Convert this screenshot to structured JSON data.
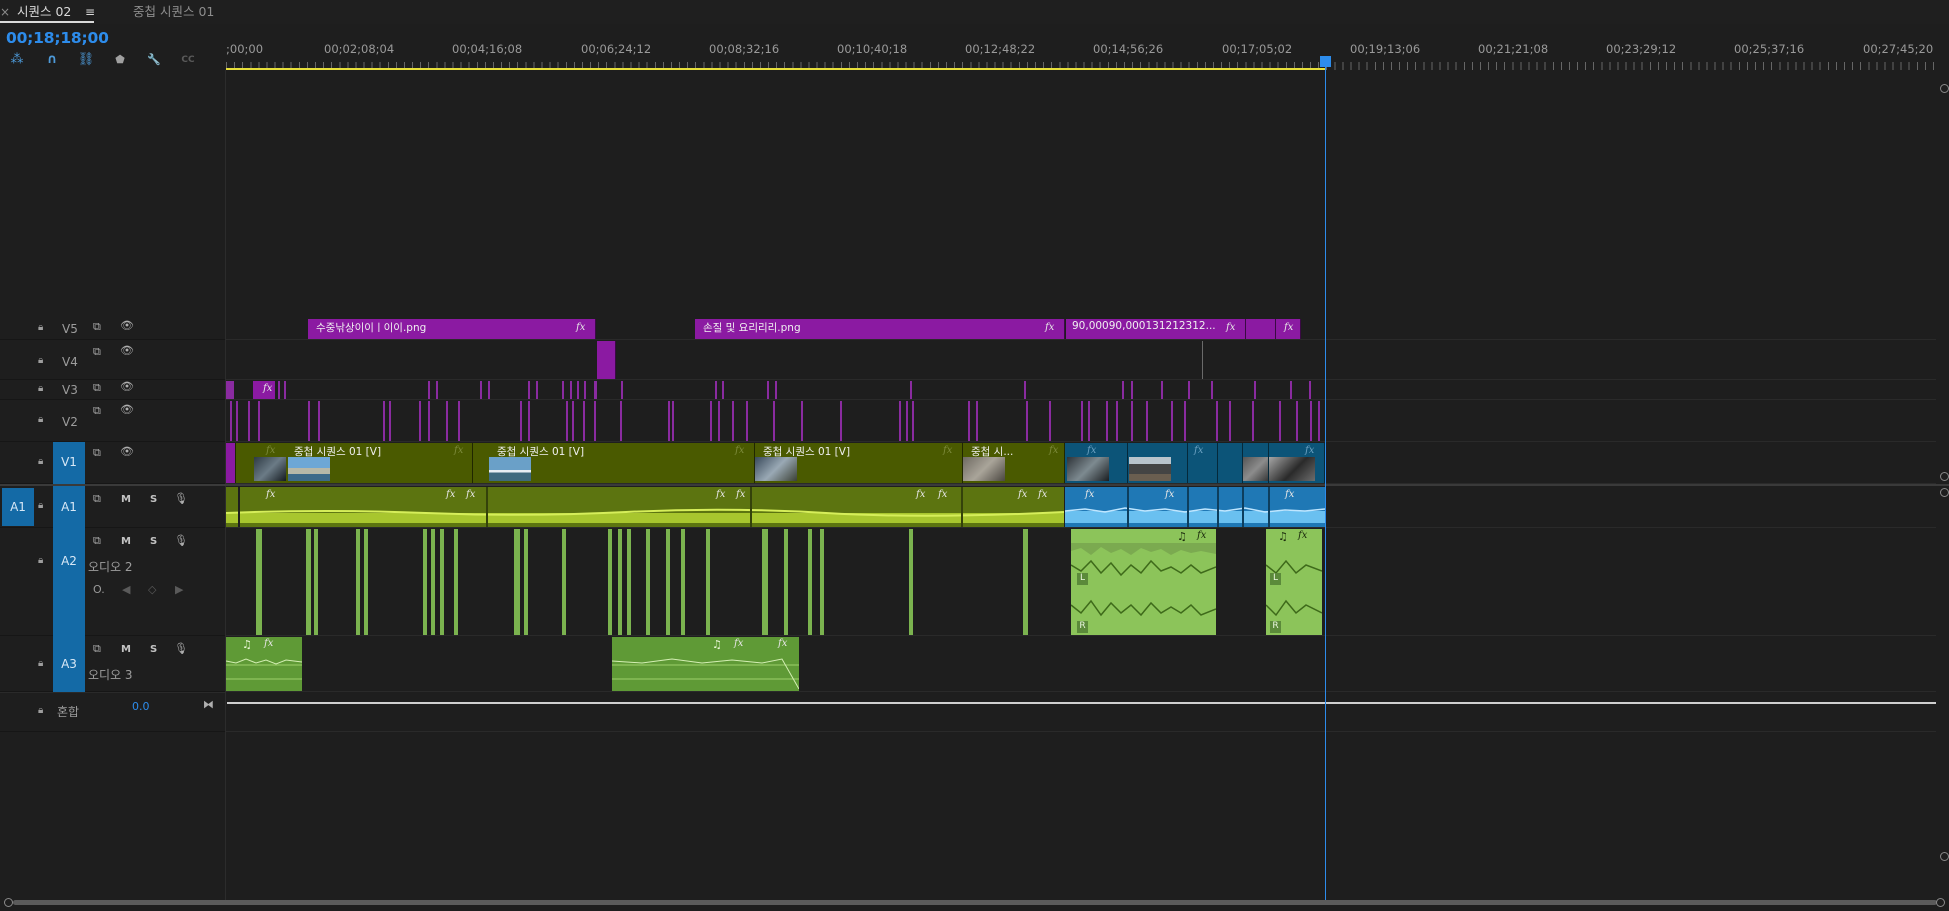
{
  "tabs": [
    {
      "label": "시퀀스 02",
      "active": true
    },
    {
      "label": "중첩 시퀀스 01",
      "active": false
    }
  ],
  "tab_close_glyph": "×",
  "tab_menu_glyph": "≡",
  "timecode": "00;18;18;00",
  "toolbar": [
    {
      "icon": "snap-nest-icon",
      "glyph": "⁂"
    },
    {
      "icon": "magnet-icon",
      "glyph": "∩"
    },
    {
      "icon": "linked-selection-icon",
      "glyph": "⛓"
    },
    {
      "icon": "marker-icon",
      "glyph": "⬟"
    },
    {
      "icon": "wrench-icon",
      "glyph": "🔧"
    },
    {
      "icon": "captions-icon",
      "glyph": "CC"
    }
  ],
  "ruler_labels": [
    ";00;00",
    "00;02;08;04",
    "00;04;16;08",
    "00;06;24;12",
    "00;08;32;16",
    "00;10;40;18",
    "00;12;48;22",
    "00;14;56;26",
    "00;17;05;02",
    "00;19;13;06",
    "00;21;21;08",
    "00;23;29;12",
    "00;25;37;16",
    "00;27;45;20"
  ],
  "tracks": {
    "video": [
      {
        "id": "V5",
        "name": "V5"
      },
      {
        "id": "V4",
        "name": "V4"
      },
      {
        "id": "V3",
        "name": "V3"
      },
      {
        "id": "V2",
        "name": "V2"
      },
      {
        "id": "V1",
        "name": "V1",
        "source": "V1"
      }
    ],
    "audio": [
      {
        "id": "A1",
        "name": "A1",
        "source": "A1"
      },
      {
        "id": "A2",
        "name": "A2",
        "label": "오디오 2"
      },
      {
        "id": "A3",
        "name": "A3",
        "label": "오디오 3"
      }
    ],
    "mix": {
      "label": "혼합",
      "value": "0.0"
    }
  },
  "mute_label": "M",
  "solo_label": "S",
  "keyframe_glyph": "◇",
  "fx_label": "fx",
  "clips": {
    "v5": [
      {
        "name": "수중낚상이이ㅣ이이.png"
      },
      {
        "name": "손질 및 요리리리.png"
      },
      {
        "name": "90,00090,000131212312..."
      }
    ],
    "v1": [
      {
        "name": "중첩 시퀀스 01 [V]"
      },
      {
        "name": "중첩 시퀀스 01 [V]"
      },
      {
        "name": "중첩 시퀀스 01 [V]"
      },
      {
        "name": "중첩 시..."
      }
    ]
  },
  "audio_channels": {
    "left": "L",
    "right": "R"
  },
  "colors": {
    "accent": "#2d8ceb",
    "work_area": "#e6de3a",
    "v5_clip": "#8b1aa2",
    "nested_clip": "#4a5a00",
    "video_blue": "#0c5478",
    "audio_green": "#8cc45a"
  }
}
